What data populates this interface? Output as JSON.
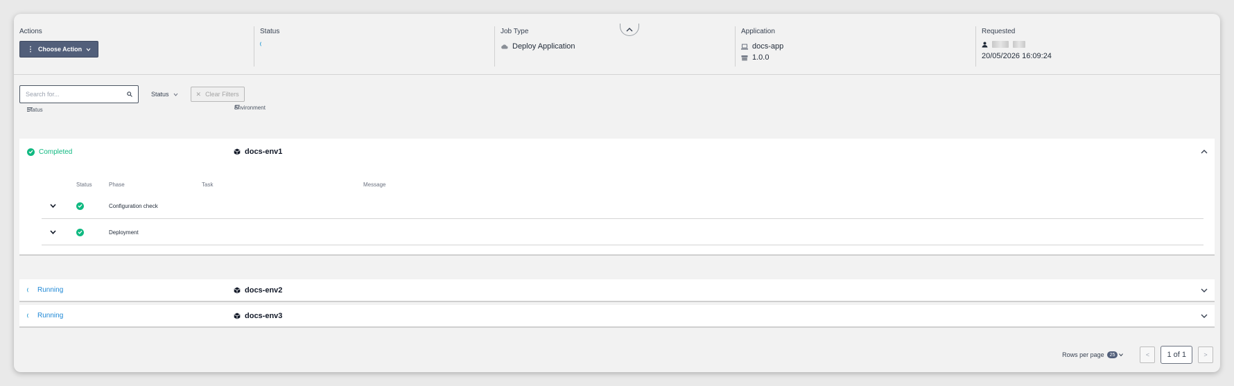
{
  "header": {
    "actions": {
      "label": "Actions",
      "button": "Choose Action"
    },
    "status": {
      "label": "Status"
    },
    "job_type": {
      "label": "Job Type",
      "value": "Deploy Application"
    },
    "application": {
      "label": "Application",
      "name": "docs-app",
      "version": "1.0.0"
    },
    "requested": {
      "label": "Requested",
      "timestamp": "20/05/2026 16:09:24"
    }
  },
  "filters": {
    "search_placeholder": "Search for...",
    "status_label": "Status",
    "clear_label": "Clear Filters"
  },
  "table": {
    "col_status": "Status",
    "col_environment": "Environment",
    "rows": [
      {
        "status": "Completed",
        "environment": "docs-env1",
        "expanded": true,
        "sub_headers": {
          "status": "Status",
          "phase": "Phase",
          "task": "Task",
          "message": "Message"
        },
        "phases": [
          {
            "phase": "Configuration check",
            "task": "",
            "message": ""
          },
          {
            "phase": "Deployment",
            "task": "",
            "message": ""
          }
        ]
      },
      {
        "status": "Running",
        "environment": "docs-env2",
        "expanded": false
      },
      {
        "status": "Running",
        "environment": "docs-env3",
        "expanded": false
      }
    ]
  },
  "pagination": {
    "rows_per_page_label": "Rows per page",
    "rows_per_page": "25",
    "prev": "<",
    "page_info": "1 of 1",
    "next": ">"
  },
  "colors": {
    "completed": "#10b981",
    "running": "#1e88d6",
    "action_button": "#525f7a"
  }
}
